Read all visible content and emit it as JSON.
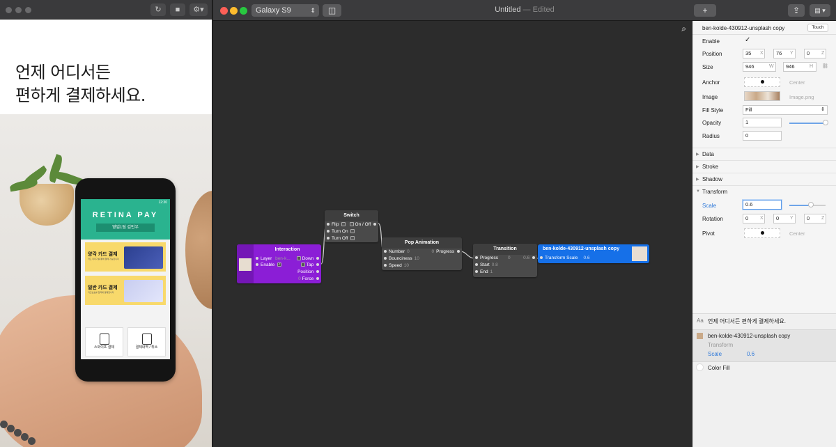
{
  "preview": {
    "headline_line1": "언제 어디서든",
    "headline_line2": "편하게 결제하세요.",
    "phone": {
      "status_time": "12:30",
      "brand": "RETINA PAY",
      "team": "영업1팀 김민우",
      "card1_title": "양각 카드 결제",
      "card1_sub": "카드 리더기를 통해 결제 가능합니다",
      "card2_title": "일반 카드 결제",
      "card2_sub": "카드번호를 입력해 결제합니다",
      "tile1_label": "스와이프 결제",
      "tile2_label": "결제내역 / 취소"
    }
  },
  "toolbar": {
    "device": "Galaxy S9",
    "title": "Untitled",
    "edited": "— Edited",
    "add_label": "+",
    "share_label": "⇪",
    "view_label": "▤ ▾"
  },
  "nodes": {
    "interaction": {
      "title": "Interaction",
      "layer_label": "Layer",
      "layer_value": "ben-k...",
      "enable_label": "Enable",
      "enable_check": "✓",
      "outputs": [
        "Down",
        "Tap",
        "Position",
        "Force"
      ],
      "force_value": "0"
    },
    "switch": {
      "title": "Switch",
      "inputs": [
        "Flip",
        "Turn On",
        "Turn Off"
      ],
      "output": "On / Off"
    },
    "pop": {
      "title": "Pop Animation",
      "inputs": [
        {
          "label": "Number",
          "value": "0"
        },
        {
          "label": "Bounciness",
          "value": "10"
        },
        {
          "label": "Speed",
          "value": "10"
        }
      ],
      "output_label": "Progress",
      "output_value": "0"
    },
    "transition": {
      "title": "Transition",
      "inputs": [
        {
          "label": "Progress",
          "value": "0"
        },
        {
          "label": "Start",
          "value": "0.8"
        },
        {
          "label": "End",
          "value": "1"
        }
      ],
      "output_value": "0.6"
    },
    "layer": {
      "title": "ben-kolde-430912-unsplash copy",
      "port_label": "Transform Scale",
      "port_value": "0.6"
    }
  },
  "inspector": {
    "layer_name": "ben-kolde-430912-unsplash copy",
    "touch_label": "Touch",
    "enable_label": "Enable",
    "enable_check": "✓",
    "position_label": "Position",
    "position": {
      "x": "35",
      "y": "76",
      "z": "0"
    },
    "size_label": "Size",
    "size": {
      "w": "946",
      "h": "946"
    },
    "anchor_label": "Anchor",
    "anchor_value": "Center",
    "image_label": "Image",
    "image_value": "Image.png",
    "fill_style_label": "Fill Style",
    "fill_style_value": "Fill",
    "opacity_label": "Opacity",
    "opacity_value": "1",
    "opacity_level": 1,
    "radius_label": "Radius",
    "radius_value": "0",
    "sections": [
      "Data",
      "Stroke",
      "Shadow"
    ],
    "transform_label": "Transform",
    "scale_label": "Scale",
    "scale_value": "0.6",
    "scale_level": 0.6,
    "rotation_label": "Rotation",
    "rotation": {
      "x": "0",
      "y": "0",
      "z": "0"
    },
    "pivot_label": "Pivot",
    "pivot_value": "Center",
    "axis": {
      "x": "X",
      "y": "Y",
      "z": "Z",
      "w": "W",
      "h": "H"
    }
  },
  "layers": {
    "text_prefix": "Aa",
    "text_layer": "언제 어디서든 편하게 결제하세요.",
    "image_layer": "ben-kolde-430912-unsplash copy",
    "image_sub": "Transform",
    "image_prop": "Scale",
    "image_prop_value": "0.6",
    "fill_layer": "Color Fill"
  },
  "colors": {
    "interaction_node": "#8b1ed6",
    "layer_node": "#1670e8",
    "node_gray": "#4a4a4a",
    "accent": "#2b77d9"
  }
}
